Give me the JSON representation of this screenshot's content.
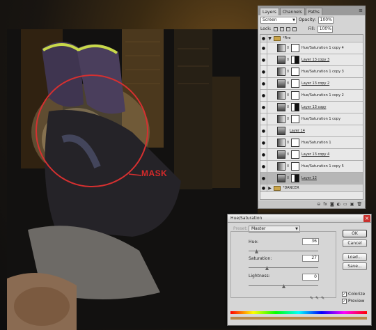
{
  "canvas": {
    "mask_label": "MASK"
  },
  "layers_panel": {
    "tabs": [
      "Layers",
      "Channels",
      "Paths"
    ],
    "blend_mode": "Screen",
    "opacity_label": "Opacity:",
    "opacity_value": "100%",
    "lock_label": "Lock:",
    "fill_label": "Fill:",
    "fill_value": "100%",
    "group_top": "*Fire",
    "group_bottom": "*DANCER",
    "layers": [
      {
        "name": "Hue/Saturation 1 copy 4",
        "kind": "adjustment"
      },
      {
        "name": "Layer 13 copy 3",
        "kind": "pixel"
      },
      {
        "name": "Hue/Saturation 1 copy 3",
        "kind": "adjustment"
      },
      {
        "name": "Layer 13 copy 2",
        "kind": "pixel"
      },
      {
        "name": "Hue/Saturation 1 copy 2",
        "kind": "adjustment"
      },
      {
        "name": "Layer 13 copy",
        "kind": "pixel"
      },
      {
        "name": "Hue/Saturation 1 copy",
        "kind": "adjustment"
      },
      {
        "name": "Layer 14",
        "kind": "pixel"
      },
      {
        "name": "Hue/Saturation 1",
        "kind": "adjustment"
      },
      {
        "name": "Layer 13 copy 4",
        "kind": "pixel"
      },
      {
        "name": "Hue/Saturation 1 copy 5",
        "kind": "adjustment"
      },
      {
        "name": "Layer 12",
        "kind": "pixel"
      }
    ]
  },
  "hue_saturation": {
    "title": "Hue/Saturation",
    "preset_label": "Preset:",
    "channel": "Master",
    "hue_label": "Hue:",
    "hue_value": "36",
    "saturation_label": "Saturation:",
    "saturation_value": "27",
    "lightness_label": "Lightness:",
    "lightness_value": "0",
    "ok": "OK",
    "cancel": "Cancel",
    "load": "Load...",
    "save": "Save...",
    "colorize_label": "Colorize",
    "preview_label": "Preview"
  }
}
